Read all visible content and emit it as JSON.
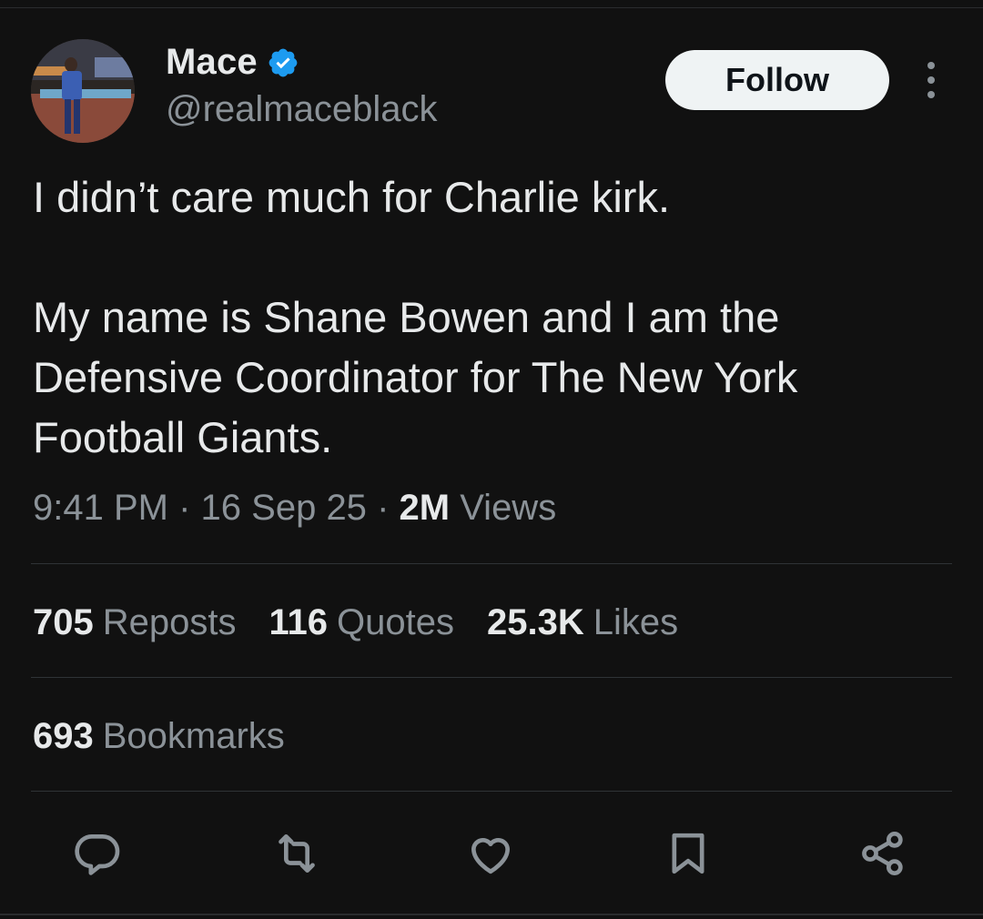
{
  "author": {
    "name": "Mace",
    "handle": "@realmaceblack",
    "verified": true,
    "verified_color": "#1d9bf0"
  },
  "follow_label": "Follow",
  "tweet": {
    "line1": "I didn’t care much for Charlie kirk.",
    "line2": "My name is Shane Bowen and I am the Defensive Coordinator for The New York Football Giants."
  },
  "meta": {
    "time": "9:41 PM",
    "sep1": "·",
    "date": "16 Sep 25",
    "sep2": "·",
    "views_count": "2M",
    "views_label": "Views"
  },
  "stats": {
    "reposts_count": "705",
    "reposts_label": "Reposts",
    "quotes_count": "116",
    "quotes_label": "Quotes",
    "likes_count": "25.3K",
    "likes_label": "Likes",
    "bookmarks_count": "693",
    "bookmarks_label": "Bookmarks"
  },
  "actions": [
    "reply-icon",
    "repost-icon",
    "like-icon",
    "bookmark-icon",
    "share-icon"
  ],
  "colors": {
    "background": "#111111",
    "text": "#e7e9ea",
    "secondary": "#8b9298",
    "divider": "#2f3336",
    "follow_bg": "#eff3f4"
  }
}
